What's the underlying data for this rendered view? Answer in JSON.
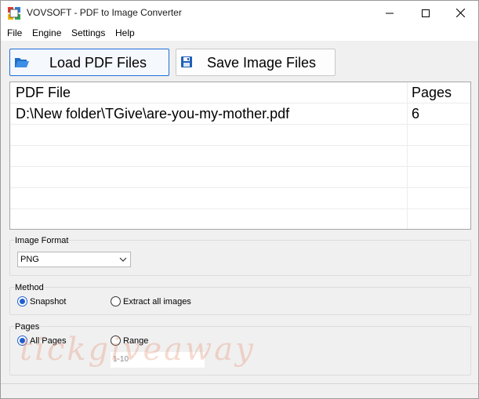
{
  "window": {
    "title": "VOVSOFT - PDF to Image Converter"
  },
  "menu": {
    "items": [
      "File",
      "Engine",
      "Settings",
      "Help"
    ]
  },
  "toolbar": {
    "load_label": "Load PDF Files",
    "save_label": "Save Image Files"
  },
  "grid": {
    "columns": [
      "PDF File",
      "Pages"
    ],
    "rows": [
      {
        "file": "D:\\New folder\\TGive\\are-you-my-mother.pdf",
        "pages": "6"
      }
    ]
  },
  "image_format": {
    "label": "Image Format",
    "selected": "PNG"
  },
  "method": {
    "label": "Method",
    "options": [
      {
        "label": "Snapshot",
        "checked": true
      },
      {
        "label": "Extract all images",
        "checked": false
      }
    ]
  },
  "pages": {
    "label": "Pages",
    "options": [
      {
        "label": "All Pages",
        "checked": true
      },
      {
        "label": "Range",
        "checked": false
      }
    ],
    "range_value": "1-10"
  },
  "watermark": "tickgiveaway",
  "colors": {
    "accent": "#1e5fcf",
    "folder": "#2d7ed8"
  }
}
